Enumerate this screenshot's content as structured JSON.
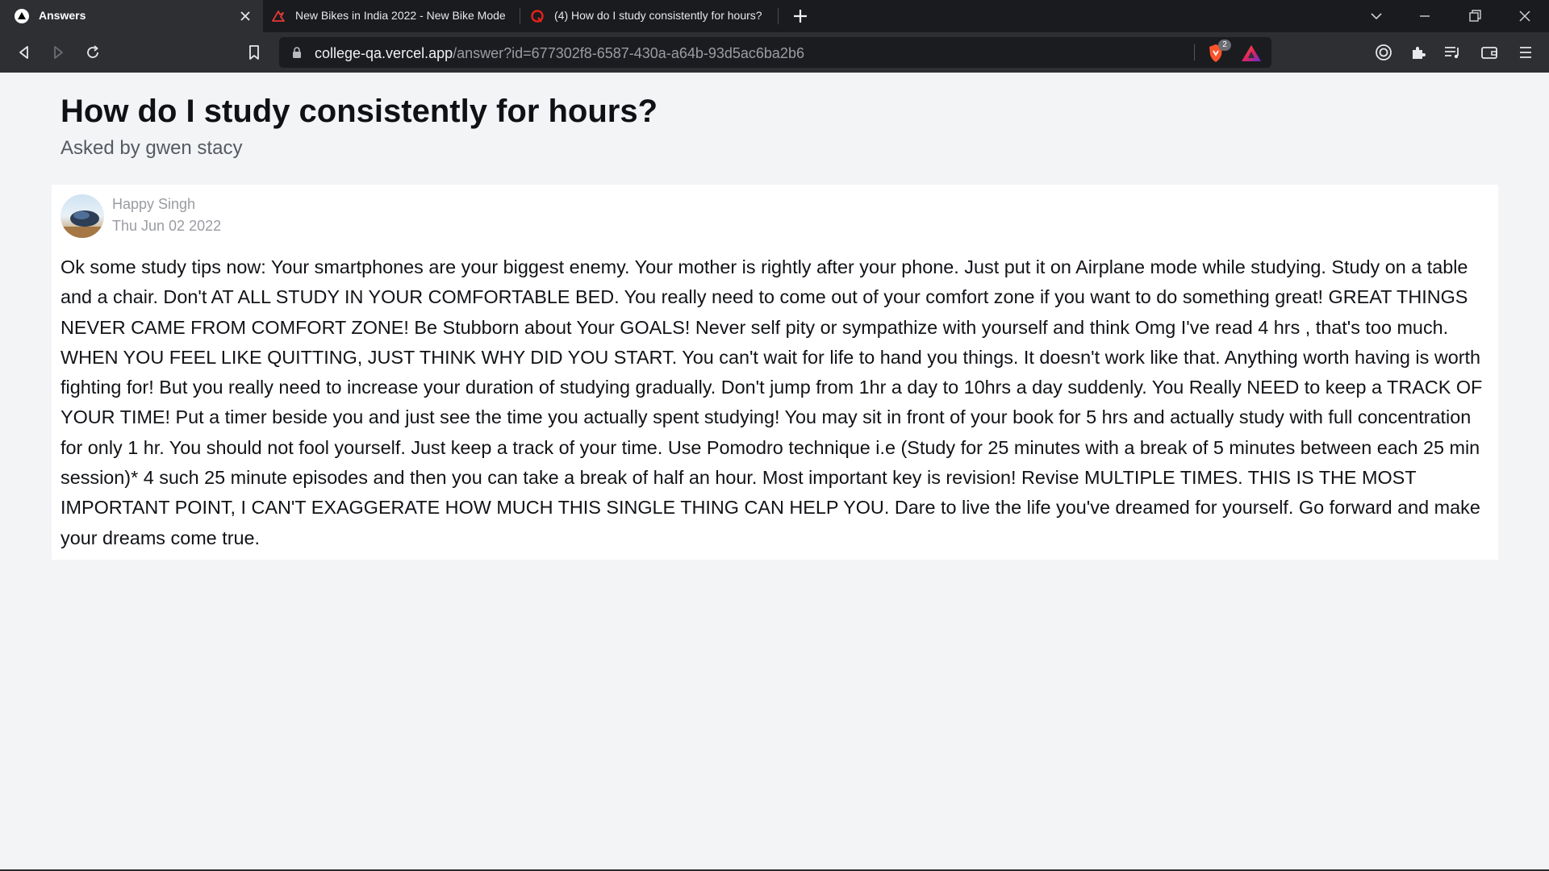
{
  "browser": {
    "tabs": [
      {
        "title": "Answers",
        "icon": "vercel-logo-icon",
        "active": true
      },
      {
        "title": "New Bikes in India 2022 - New Bike Mode",
        "icon": "bikewale-icon",
        "active": false
      },
      {
        "title": "(4) How do I study consistently for hours?",
        "icon": "quora-icon",
        "active": false
      }
    ],
    "url_host": "college-qa.vercel.app",
    "url_path": "/answer?id=677302f8-6587-430a-a64b-93d5ac6ba2b6",
    "shields_count": "2",
    "colors": {
      "tabbar": "#1a1b1f",
      "toolbar": "#2d2f33",
      "urlbar": "#1b1c20",
      "shields": "#fb542b",
      "rewards": "#7b2ff7"
    }
  },
  "question": {
    "title": "How do I study consistently for hours?",
    "asked_by": "Asked by gwen stacy"
  },
  "answer": {
    "author": "Happy Singh",
    "date": "Thu Jun 02 2022",
    "body": "Ok some study tips now: Your smartphones are your biggest enemy. Your mother is rightly after your phone. Just put it on Airplane mode while studying. Study on a table and a chair. Don't AT ALL STUDY IN YOUR COMFORTABLE BED. You really need to come out of your comfort zone if you want to do something great! GREAT THINGS NEVER CAME FROM COMFORT ZONE! Be Stubborn about Your GOALS! Never self pity or sympathize with yourself and think Omg I've read 4 hrs , that's too much. WHEN YOU FEEL LIKE QUITTING, JUST THINK WHY DID YOU START. You can't wait for life to hand you things. It doesn't work like that. Anything worth having is worth fighting for! But you really need to increase your duration of studying gradually. Don't jump from 1hr a day to 10hrs a day suddenly. You Really NEED to keep a TRACK OF YOUR TIME! Put a timer beside you and just see the time you actually spent studying! You may sit in front of your book for 5 hrs and actually study with full concentration for only 1 hr. You should not fool yourself. Just keep a track of your time. Use Pomodro technique i.e (Study for 25 minutes with a break of 5 minutes between each 25 min session)* 4 such 25 minute episodes and then you can take a break of half an hour. Most important key is revision! Revise MULTIPLE TIMES. THIS IS THE MOST IMPORTANT POINT, I CAN'T EXAGGERATE HOW MUCH THIS SINGLE THING CAN HELP YOU. Dare to live the life you've dreamed for yourself. Go forward and make your dreams come true."
  }
}
